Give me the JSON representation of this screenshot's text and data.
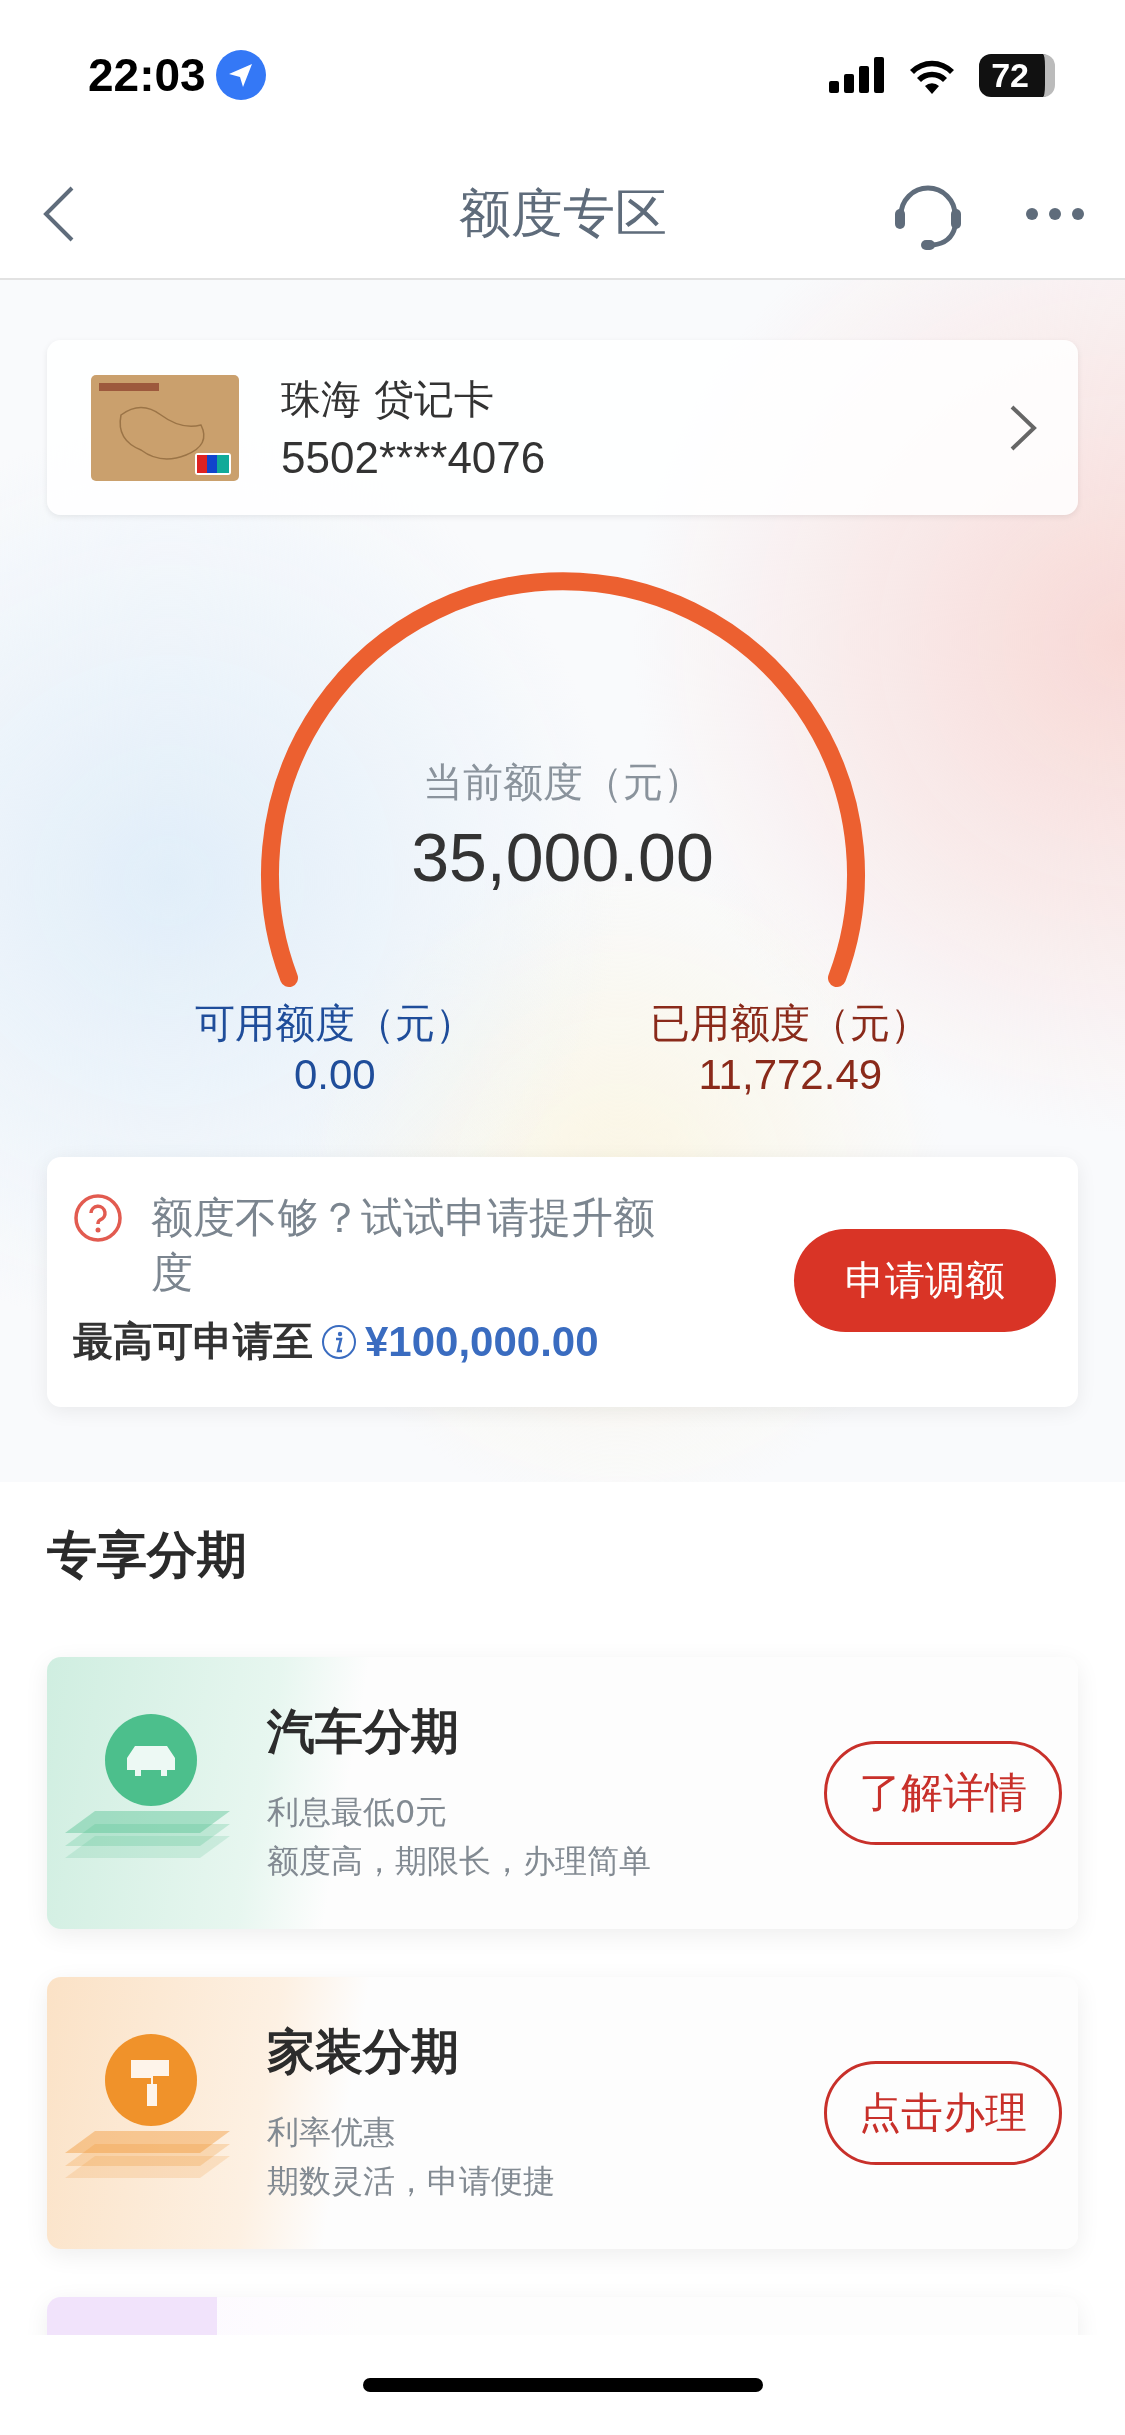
{
  "status_bar": {
    "time": "22:03",
    "battery": "72"
  },
  "nav": {
    "title": "额度专区"
  },
  "card": {
    "name": "珠海 贷记卡",
    "number": "5502****4076"
  },
  "gauge": {
    "label": "当前额度（元）",
    "value": "35,000.00"
  },
  "balances": [
    {
      "label": "可用额度（元）",
      "value": "0.00",
      "color": "#1f4d9a"
    },
    {
      "label": "已用额度（元）",
      "value": "11,772.49",
      "color": "#8a2a1a"
    }
  ],
  "apply": {
    "hint": "额度不够？试试申请提升额度",
    "max_label": "最高可申请至",
    "max_value": "¥100,000.00",
    "button": "申请调额"
  },
  "section_title": "专享分期",
  "installments": [
    {
      "kind": "car",
      "color": "#4cbf8c",
      "title": "汽车分期",
      "lines": [
        "利息最低0元",
        "额度高，期限长，办理简单"
      ],
      "button": "了解详情"
    },
    {
      "kind": "paint",
      "color": "#f0922a",
      "title": "家装分期",
      "lines": [
        "利率优惠",
        "期数灵活，申请便捷"
      ],
      "button": "点击办理"
    },
    {
      "kind": "partial",
      "color": "#f1e3fb"
    }
  ]
}
